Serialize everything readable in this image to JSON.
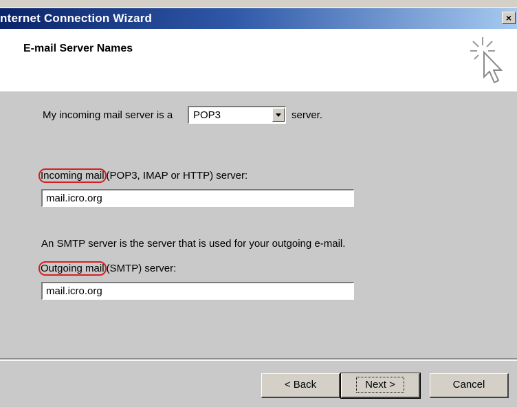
{
  "window": {
    "title": "nternet Connection Wizard",
    "close_label": "×"
  },
  "header": {
    "title": "E-mail Server Names",
    "icon": "wizard-sparkle-cursor-icon"
  },
  "incoming_type": {
    "prefix": "My incoming mail server is a",
    "value": "POP3",
    "suffix": "server."
  },
  "incoming": {
    "label_circled": "Incoming mail",
    "label_rest": "(POP3, IMAP or HTTP) server:",
    "value": "mail.icro.org"
  },
  "smtp_info": "An SMTP server is the server that is used for your outgoing e-mail.",
  "outgoing": {
    "label_circled": "Outgoing mail",
    "label_rest": "(SMTP) server:",
    "value": "mail.icro.org"
  },
  "buttons": {
    "back": "< Back",
    "next": "Next >",
    "cancel": "Cancel"
  },
  "colors": {
    "annotation": "#d42020",
    "title_bar": "#0a246a"
  }
}
